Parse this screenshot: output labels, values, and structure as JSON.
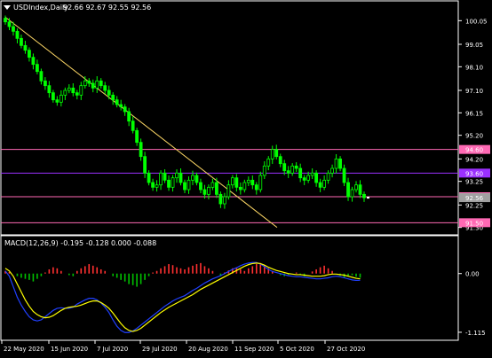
{
  "header": {
    "symbol_tf": "USDIndex,Daily",
    "ohlc": "92.66 92.67 92.55 92.56",
    "menu_icon": "triangle-down-icon"
  },
  "macd": {
    "label": "MACD(12,26,9) -0.195 -0.128 0.000 -0.088"
  },
  "colors": {
    "background": "#000000",
    "up_candle": "#00ff00",
    "down_candle": "#00ff00",
    "trendline": "#ffd966",
    "level_lines": "#ff69b4",
    "mid_level_line": "#9b30ff",
    "macd_pos_hist": "#ff3030",
    "macd_neg_hist": "#00c000",
    "macd_signal": "#ffff00",
    "macd_line": "#2040ff",
    "current_price_tag": "#ffffff"
  },
  "chart_data": [
    {
      "type": "line",
      "title": "USDIndex,Daily",
      "x": [
        "22 May 2020",
        "15 Jun 2020",
        "7 Jul 2020",
        "29 Jul 2020",
        "20 Aug 2020",
        "11 Sep 2020",
        "5 Oct 2020",
        "27 Oct 2020"
      ],
      "y_ticks": [
        "100.05",
        "99.05",
        "98.10",
        "97.10",
        "96.15",
        "95.20",
        "94.20",
        "93.25",
        "92.25",
        "91.30"
      ],
      "ylim": [
        91.1,
        100.4
      ],
      "series": [
        {
          "values": [
            100.0,
            99.8,
            99.6,
            99.3,
            99.0,
            98.8,
            98.5,
            98.2,
            97.9,
            97.5,
            97.3,
            97.0,
            96.7,
            96.6,
            96.9,
            97.1,
            97.2,
            97.0,
            96.9,
            97.3,
            97.5,
            97.4,
            97.2,
            97.5,
            97.3,
            97.1,
            96.9,
            96.7,
            96.5,
            96.4,
            96.2,
            95.8,
            95.4,
            94.9,
            94.3,
            93.6,
            93.2,
            93.0,
            93.1,
            93.6,
            93.3,
            93.0,
            93.4,
            93.6,
            93.2,
            92.9,
            93.3,
            93.5,
            93.2,
            92.9,
            92.7,
            93.0,
            93.2,
            92.7,
            92.3,
            92.6,
            93.1,
            93.4,
            93.0,
            92.9,
            93.2,
            93.3,
            93.1,
            92.9,
            93.5,
            93.9,
            94.2,
            94.6,
            94.3,
            94.0,
            93.7,
            93.6,
            93.9,
            93.8,
            93.4,
            93.3,
            93.5,
            93.6,
            93.2,
            93.0,
            93.3,
            93.6,
            93.8,
            94.2,
            93.8,
            93.2,
            92.6,
            92.9,
            93.1,
            92.7,
            92.56
          ]
        }
      ],
      "horizontal_levels": [
        "94.60",
        "93.60",
        "92.60",
        "91.50"
      ],
      "price_tags": [
        "94.60",
        "93.60",
        "92.60",
        "92.56",
        "91.50"
      ],
      "trendline": {
        "from": [
          "22 May 2020",
          100.2
        ],
        "to": [
          "5 Oct 2020",
          91.3
        ]
      },
      "grid": false
    },
    {
      "type": "bar",
      "title": "MACD(12,26,9) -0.195 -0.128 0.000 -0.088",
      "y_ticks": [
        "0.00",
        "-1.115"
      ],
      "ylim": [
        -1.2,
        0.45
      ],
      "histogram": [
        0.05,
        0.03,
        0.0,
        -0.05,
        -0.08,
        -0.1,
        -0.12,
        -0.15,
        -0.1,
        -0.05,
        0.02,
        0.08,
        0.12,
        0.1,
        0.05,
        0.0,
        -0.03,
        -0.05,
        0.05,
        0.1,
        0.14,
        0.18,
        0.15,
        0.12,
        0.08,
        0.05,
        0.0,
        -0.05,
        -0.08,
        -0.12,
        -0.15,
        -0.2,
        -0.22,
        -0.25,
        -0.2,
        -0.12,
        -0.05,
        0.02,
        0.05,
        0.1,
        0.14,
        0.18,
        0.16,
        0.12,
        0.1,
        0.08,
        0.12,
        0.15,
        0.18,
        0.2,
        0.14,
        0.1,
        0.05,
        0.0,
        -0.05,
        0.02,
        0.06,
        0.1,
        0.12,
        0.08,
        0.05,
        0.1,
        0.14,
        0.18,
        0.2,
        0.16,
        0.1,
        0.05,
        0.0,
        -0.03,
        -0.05,
        -0.02,
        0.0,
        0.02,
        -0.02,
        -0.05,
        0.0,
        0.04,
        0.08,
        0.12,
        0.15,
        0.1,
        0.05,
        0.0,
        -0.04,
        -0.08,
        -0.05,
        -0.03,
        -0.06,
        -0.08
      ],
      "signal": [
        0.1,
        0.05,
        -0.05,
        -0.2,
        -0.35,
        -0.5,
        -0.62,
        -0.72,
        -0.78,
        -0.82,
        -0.84,
        -0.83,
        -0.8,
        -0.75,
        -0.7,
        -0.66,
        -0.64,
        -0.63,
        -0.62,
        -0.6,
        -0.57,
        -0.54,
        -0.52,
        -0.52,
        -0.55,
        -0.6,
        -0.66,
        -0.75,
        -0.85,
        -0.95,
        -1.03,
        -1.08,
        -1.1,
        -1.08,
        -1.04,
        -0.98,
        -0.92,
        -0.86,
        -0.8,
        -0.74,
        -0.69,
        -0.64,
        -0.6,
        -0.56,
        -0.52,
        -0.48,
        -0.44,
        -0.4,
        -0.35,
        -0.3,
        -0.26,
        -0.22,
        -0.18,
        -0.14,
        -0.1,
        -0.06,
        -0.02,
        0.02,
        0.06,
        0.1,
        0.14,
        0.17,
        0.19,
        0.2,
        0.19,
        0.16,
        0.12,
        0.09,
        0.06,
        0.04,
        0.02,
        0.0,
        -0.01,
        -0.02,
        -0.02,
        -0.03,
        -0.04,
        -0.05,
        -0.05,
        -0.05,
        -0.04,
        -0.02,
        -0.01,
        -0.01,
        -0.02,
        -0.03,
        -0.05,
        -0.07,
        -0.09,
        -0.1
      ],
      "macd_line": [
        0.05,
        -0.05,
        -0.25,
        -0.45,
        -0.6,
        -0.72,
        -0.82,
        -0.88,
        -0.9,
        -0.88,
        -0.82,
        -0.76,
        -0.7,
        -0.66,
        -0.65,
        -0.66,
        -0.66,
        -0.64,
        -0.58,
        -0.54,
        -0.5,
        -0.47,
        -0.47,
        -0.5,
        -0.56,
        -0.64,
        -0.74,
        -0.88,
        -1.0,
        -1.08,
        -1.12,
        -1.12,
        -1.09,
        -1.04,
        -0.98,
        -0.92,
        -0.86,
        -0.8,
        -0.74,
        -0.68,
        -0.62,
        -0.57,
        -0.52,
        -0.48,
        -0.45,
        -0.42,
        -0.37,
        -0.32,
        -0.28,
        -0.23,
        -0.18,
        -0.14,
        -0.1,
        -0.07,
        -0.04,
        0.0,
        0.04,
        0.08,
        0.11,
        0.15,
        0.18,
        0.2,
        0.21,
        0.21,
        0.18,
        0.13,
        0.08,
        0.04,
        0.02,
        0.0,
        -0.02,
        -0.04,
        -0.05,
        -0.06,
        -0.06,
        -0.07,
        -0.08,
        -0.09,
        -0.1,
        -0.1,
        -0.09,
        -0.08,
        -0.06,
        -0.05,
        -0.06,
        -0.08,
        -0.1,
        -0.12,
        -0.13,
        -0.128
      ],
      "grid": false
    }
  ]
}
